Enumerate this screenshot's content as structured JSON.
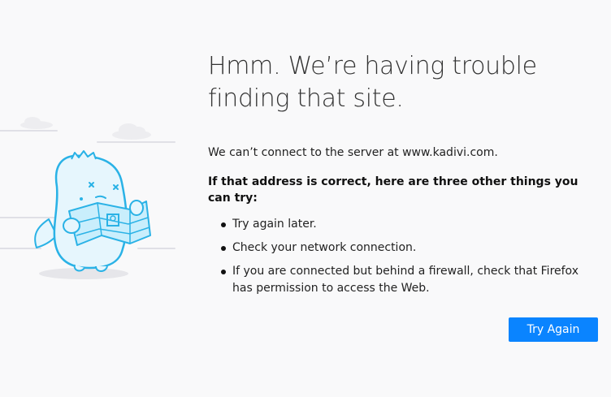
{
  "error": {
    "title": "Hmm. We’re having trouble finding that site.",
    "description": "We can’t connect to the server at www.kadivi.com.",
    "subheading": "If that address is correct, here are three other things you can try:",
    "tips": [
      "Try again later.",
      "Check your network connection.",
      "If you are connected but behind a firewall, check that Firefox has permission to access the Web."
    ],
    "try_again_label": "Try Again"
  },
  "colors": {
    "background": "#f9f9fa",
    "accent": "#0a84ff",
    "illustration_stroke": "#2ab2e6",
    "illustration_fill": "#e6f6fd"
  },
  "icons": {
    "illustration": "confused-monster-with-map-illustration",
    "bullet": "bullet-dot"
  }
}
